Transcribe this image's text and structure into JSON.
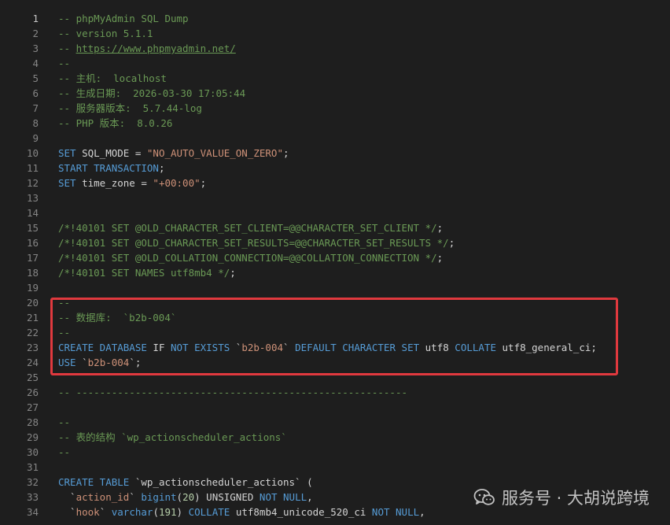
{
  "editor": {
    "active_line": 1,
    "lines": [
      {
        "n": "1",
        "tokens": [
          {
            "t": "-- phpMyAdmin SQL Dump",
            "c": "comment"
          }
        ]
      },
      {
        "n": "2",
        "tokens": [
          {
            "t": "-- version 5.1.1",
            "c": "comment"
          }
        ]
      },
      {
        "n": "3",
        "tokens": [
          {
            "t": "-- ",
            "c": "comment"
          },
          {
            "t": "https://www.phpmyadmin.net/",
            "c": "link"
          }
        ]
      },
      {
        "n": "4",
        "tokens": [
          {
            "t": "--",
            "c": "comment"
          }
        ]
      },
      {
        "n": "5",
        "tokens": [
          {
            "t": "-- 主机:  localhost",
            "c": "comment"
          }
        ]
      },
      {
        "n": "6",
        "tokens": [
          {
            "t": "-- 生成日期:  2026-03-30 17:05:44",
            "c": "comment"
          }
        ]
      },
      {
        "n": "7",
        "tokens": [
          {
            "t": "-- 服务器版本:  5.7.44-log",
            "c": "comment"
          }
        ]
      },
      {
        "n": "8",
        "tokens": [
          {
            "t": "-- PHP 版本:  8.0.26",
            "c": "comment"
          }
        ]
      },
      {
        "n": "9",
        "tokens": []
      },
      {
        "n": "10",
        "tokens": [
          {
            "t": "SET",
            "c": "kw"
          },
          {
            "t": " SQL_MODE = ",
            "c": "plain"
          },
          {
            "t": "\"NO_AUTO_VALUE_ON_ZERO\"",
            "c": "str"
          },
          {
            "t": ";",
            "c": "plain"
          }
        ]
      },
      {
        "n": "11",
        "tokens": [
          {
            "t": "START TRANSACTION",
            "c": "kw"
          },
          {
            "t": ";",
            "c": "plain"
          }
        ]
      },
      {
        "n": "12",
        "tokens": [
          {
            "t": "SET",
            "c": "kw"
          },
          {
            "t": " time_zone = ",
            "c": "plain"
          },
          {
            "t": "\"+00:00\"",
            "c": "str"
          },
          {
            "t": ";",
            "c": "plain"
          }
        ]
      },
      {
        "n": "13",
        "tokens": []
      },
      {
        "n": "14",
        "tokens": []
      },
      {
        "n": "15",
        "tokens": [
          {
            "t": "/*!40101 SET @OLD_CHARACTER_SET_CLIENT=@@CHARACTER_SET_CLIENT */",
            "c": "comment"
          },
          {
            "t": ";",
            "c": "plain"
          }
        ]
      },
      {
        "n": "16",
        "tokens": [
          {
            "t": "/*!40101 SET @OLD_CHARACTER_SET_RESULTS=@@CHARACTER_SET_RESULTS */",
            "c": "comment"
          },
          {
            "t": ";",
            "c": "plain"
          }
        ]
      },
      {
        "n": "17",
        "tokens": [
          {
            "t": "/*!40101 SET @OLD_COLLATION_CONNECTION=@@COLLATION_CONNECTION */",
            "c": "comment"
          },
          {
            "t": ";",
            "c": "plain"
          }
        ]
      },
      {
        "n": "18",
        "tokens": [
          {
            "t": "/*!40101 SET NAMES utf8mb4 */",
            "c": "comment"
          },
          {
            "t": ";",
            "c": "plain"
          }
        ]
      },
      {
        "n": "19",
        "tokens": []
      },
      {
        "n": "20",
        "tokens": [
          {
            "t": "--",
            "c": "comment"
          }
        ]
      },
      {
        "n": "21",
        "tokens": [
          {
            "t": "-- 数据库:  `b2b-004`",
            "c": "comment"
          }
        ]
      },
      {
        "n": "22",
        "tokens": [
          {
            "t": "--",
            "c": "comment"
          }
        ]
      },
      {
        "n": "23",
        "tokens": [
          {
            "t": "CREATE DATABASE ",
            "c": "kw"
          },
          {
            "t": "IF ",
            "c": "plain"
          },
          {
            "t": "NOT EXISTS ",
            "c": "kw"
          },
          {
            "t": "`",
            "c": "plain"
          },
          {
            "t": "b2b-004",
            "c": "str"
          },
          {
            "t": "` ",
            "c": "plain"
          },
          {
            "t": "DEFAULT CHARACTER SET ",
            "c": "kw"
          },
          {
            "t": "utf8 ",
            "c": "plain"
          },
          {
            "t": "COLLATE ",
            "c": "kw"
          },
          {
            "t": "utf8_general_ci;",
            "c": "plain"
          }
        ]
      },
      {
        "n": "24",
        "tokens": [
          {
            "t": "USE ",
            "c": "kw"
          },
          {
            "t": "`",
            "c": "plain"
          },
          {
            "t": "b2b-004",
            "c": "str"
          },
          {
            "t": "`;",
            "c": "plain"
          }
        ]
      },
      {
        "n": "25",
        "tokens": []
      },
      {
        "n": "26",
        "tokens": [
          {
            "t": "-- --------------------------------------------------------",
            "c": "comment"
          }
        ]
      },
      {
        "n": "27",
        "tokens": []
      },
      {
        "n": "28",
        "tokens": [
          {
            "t": "--",
            "c": "comment"
          }
        ]
      },
      {
        "n": "29",
        "tokens": [
          {
            "t": "-- 表的结构 `wp_actionscheduler_actions`",
            "c": "comment"
          }
        ]
      },
      {
        "n": "30",
        "tokens": [
          {
            "t": "--",
            "c": "comment"
          }
        ]
      },
      {
        "n": "31",
        "tokens": []
      },
      {
        "n": "32",
        "tokens": [
          {
            "t": "CREATE TABLE ",
            "c": "kw"
          },
          {
            "t": "`wp_actionscheduler_actions` (",
            "c": "plain"
          }
        ]
      },
      {
        "n": "33",
        "tokens": [
          {
            "t": "  `",
            "c": "plain"
          },
          {
            "t": "action_id",
            "c": "str"
          },
          {
            "t": "` ",
            "c": "plain"
          },
          {
            "t": "bigint",
            "c": "kw"
          },
          {
            "t": "(",
            "c": "plain"
          },
          {
            "t": "20",
            "c": "num"
          },
          {
            "t": ") UNSIGNED ",
            "c": "plain"
          },
          {
            "t": "NOT NULL",
            "c": "kw"
          },
          {
            "t": ",",
            "c": "plain"
          }
        ]
      },
      {
        "n": "34",
        "tokens": [
          {
            "t": "  `",
            "c": "plain"
          },
          {
            "t": "hook",
            "c": "str"
          },
          {
            "t": "` ",
            "c": "plain"
          },
          {
            "t": "varchar",
            "c": "kw"
          },
          {
            "t": "(",
            "c": "plain"
          },
          {
            "t": "191",
            "c": "num"
          },
          {
            "t": ") ",
            "c": "plain"
          },
          {
            "t": "COLLATE ",
            "c": "kw"
          },
          {
            "t": "utf8mb4_unicode_520_ci ",
            "c": "plain"
          },
          {
            "t": "NOT NULL",
            "c": "kw"
          },
          {
            "t": ",",
            "c": "plain"
          }
        ]
      }
    ]
  },
  "highlight": {
    "color": "#e0393e"
  },
  "watermark": {
    "icon": "wechat-icon",
    "text": "服务号 · 大胡说跨境"
  }
}
